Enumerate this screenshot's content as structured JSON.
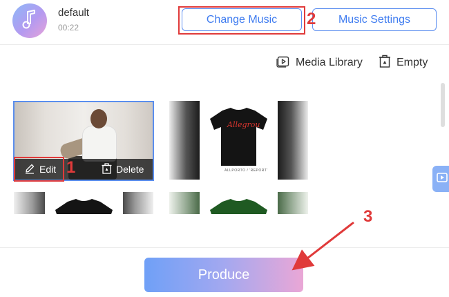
{
  "music": {
    "title": "default",
    "duration": "00:22",
    "icon": "music-note-icon"
  },
  "header_buttons": {
    "change_music": "Change Music",
    "music_settings": "Music Settings"
  },
  "toolbar": {
    "media_library": "Media Library",
    "empty": "Empty"
  },
  "tiles": {
    "edit_label": "Edit",
    "delete_label": "Delete"
  },
  "shirt": {
    "logo_text": "Allegrou",
    "caption": "ALLPORTO / 'REPORT'"
  },
  "annotations": {
    "step1": "1",
    "step2": "2",
    "step3": "3"
  },
  "produce": {
    "label": "Produce"
  },
  "colors": {
    "accent_blue": "#3f7cf0",
    "annotation_red": "#e03a3a"
  }
}
